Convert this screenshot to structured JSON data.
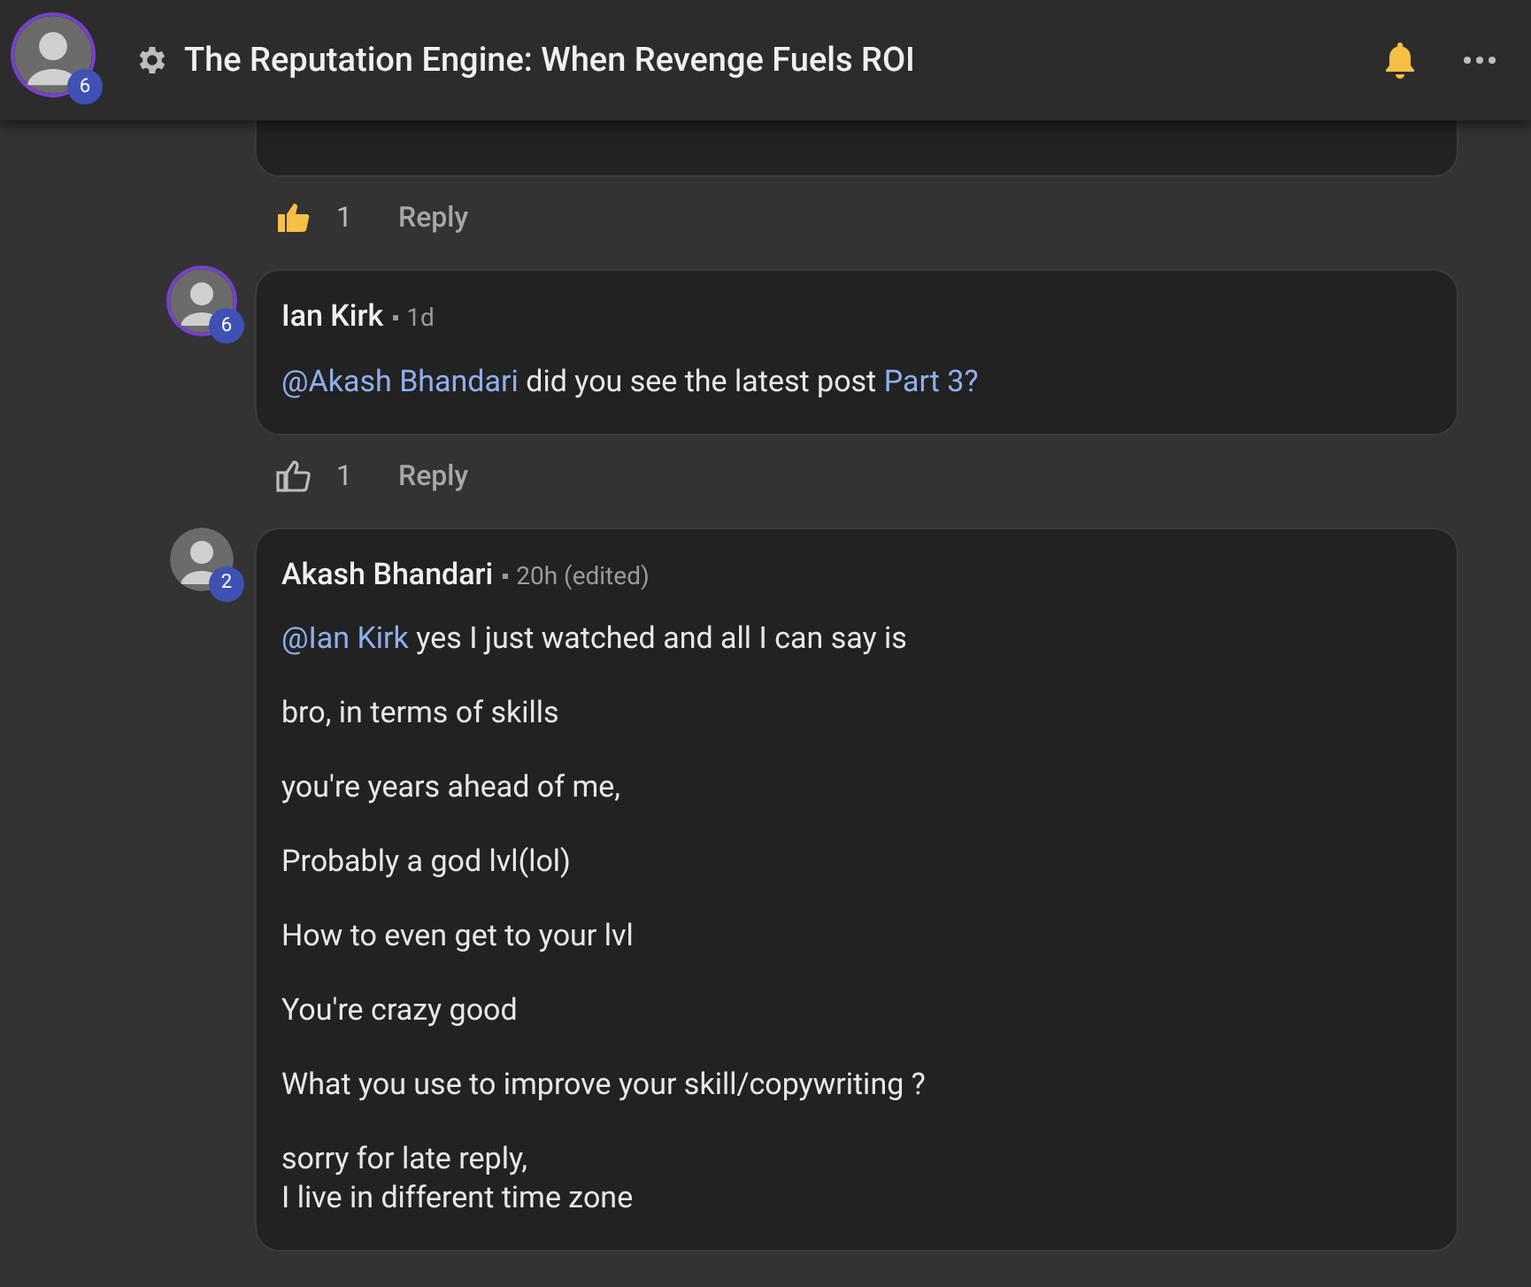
{
  "header": {
    "avatar_badge": "6",
    "title": "The Reputation Engine: When Revenge Fuels ROI"
  },
  "comments": [
    {
      "liked": true,
      "likes": "1",
      "reply": "Reply"
    },
    {
      "author": "Ian Kirk",
      "avatar_badge": "6",
      "ring": true,
      "time": "1d",
      "paragraphs": [
        [
          {
            "kind": "mention",
            "text": "@Akash Bhandari"
          },
          {
            "kind": "text",
            "text": " did you see the latest post "
          },
          {
            "kind": "link",
            "text": "Part 3?"
          }
        ]
      ],
      "liked": false,
      "likes": "1",
      "reply": "Reply"
    },
    {
      "author": "Akash Bhandari",
      "avatar_badge": "2",
      "ring": false,
      "time": "20h (edited)",
      "paragraphs": [
        [
          {
            "kind": "mention",
            "text": "@Ian Kirk"
          },
          {
            "kind": "text",
            "text": " yes I just watched and all I can say is"
          }
        ],
        [
          {
            "kind": "text",
            "text": "bro, in terms of skills"
          }
        ],
        [
          {
            "kind": "text",
            "text": "you're years ahead of me,"
          }
        ],
        [
          {
            "kind": "text",
            "text": "Probably a god lvl(lol)"
          }
        ],
        [
          {
            "kind": "text",
            "text": "How to even get to your lvl"
          }
        ],
        [
          {
            "kind": "text",
            "text": "You're crazy good"
          }
        ],
        [
          {
            "kind": "text",
            "text": "What you use to improve your skill/copywriting ?"
          }
        ],
        [
          {
            "kind": "text",
            "text": "sorry for late reply,\nI live in different time zone"
          }
        ]
      ]
    }
  ]
}
